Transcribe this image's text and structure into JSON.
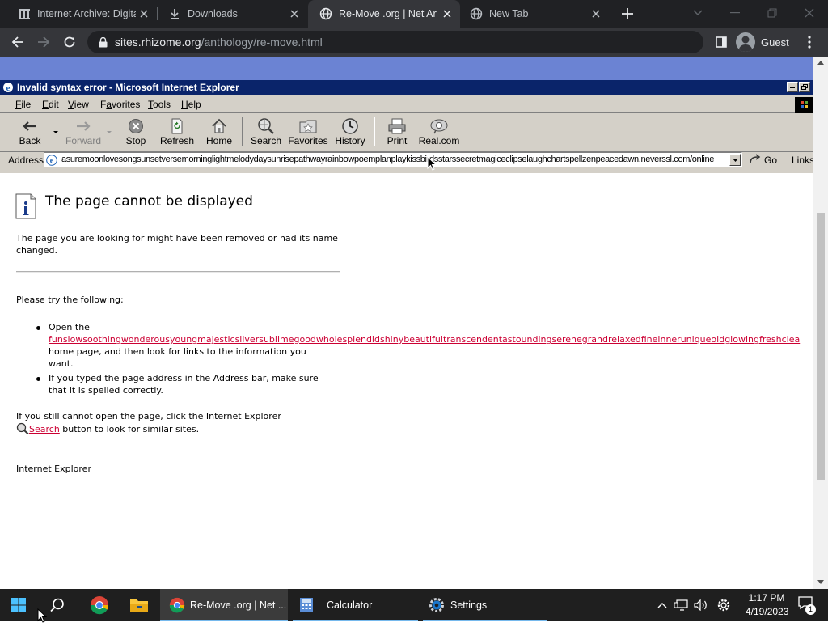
{
  "browser": {
    "tabs": [
      {
        "title": "Internet Archive: Digita",
        "favicon": "archive-icon",
        "active": false
      },
      {
        "title": "Downloads",
        "favicon": "download-icon",
        "active": false
      },
      {
        "title": "Re-Move .org | Net Art",
        "favicon": "globe-icon",
        "active": true
      },
      {
        "title": "New Tab",
        "favicon": "globe-icon",
        "active": false
      }
    ],
    "url_host": "sites.rhizome.org",
    "url_path": "/anthology/re-move.html",
    "profile_label": "Guest"
  },
  "ie": {
    "window_title": "Invalid syntax error - Microsoft Internet Explorer",
    "menu": [
      {
        "key": "F",
        "rest": "ile"
      },
      {
        "key": "E",
        "rest": "dit"
      },
      {
        "key": "V",
        "rest": "iew"
      },
      {
        "key": "",
        "rest": "Favorites",
        "key_after": "a"
      },
      {
        "key": "T",
        "rest": "ools"
      },
      {
        "key": "H",
        "rest": "elp"
      }
    ],
    "toolbar": {
      "back": "Back",
      "forward": "Forward",
      "stop": "Stop",
      "refresh": "Refresh",
      "home": "Home",
      "search": "Search",
      "favorites": "Favorites",
      "history": "History",
      "print": "Print",
      "realcom": "Real.com"
    },
    "address_label": "Address",
    "address_value": "asuremoonlovesongsunsetversemorninglightmelodydaysunrisepathwayrainbowpoemplanplaykissbirdsstarssecretmagiceclipselaughchartspellzenpeacedawn.neverssl.com/online",
    "go_label": "Go",
    "links_label": "Links",
    "content": {
      "title": "The page cannot be displayed",
      "desc": "The page you are looking for might have been removed or had its name changed.",
      "try_label": "Please try the following:",
      "bullet1_prefix": "Open the",
      "bullet1_link": "funslowsoothingwonderousyoungmajesticsilversublimegoodwholesplendidshinybeautifultranscendentastoundingserenegrandrelaxedfineinneruniqueoldglowingfreshclea",
      "bullet1_suffix": "home page, and then look for links to the information you want.",
      "bullet2": "If you typed the page address in the Address bar, make sure that it is spelled correctly.",
      "still_text": "If you still cannot open the page, click the Internet Explorer",
      "search_link": "Search",
      "still_suffix": " button to look for similar sites.",
      "footer": "Internet Explorer"
    }
  },
  "taskbar": {
    "apps": [
      {
        "label": "Re-Move .org | Net ...",
        "active": true
      },
      {
        "label": "Calculator",
        "active": false
      },
      {
        "label": "Settings",
        "active": false
      }
    ],
    "time": "1:17 PM",
    "date": "4/19/2023",
    "notification_count": "1"
  },
  "colors": {
    "chrome_frame": "#202124",
    "chrome_toolbar": "#35363a",
    "ie_titlebar": "#0a246a",
    "ie_face": "#d4d0c8",
    "page_band": "#6b83d3",
    "link_red": "#cc0033",
    "taskbar": "#1f1f1f"
  }
}
